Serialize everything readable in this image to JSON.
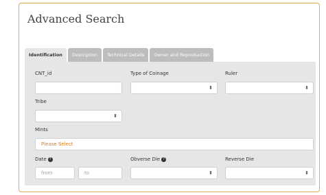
{
  "page": {
    "title": "Advanced Search"
  },
  "tabs": [
    {
      "label": "Identification"
    },
    {
      "label": "Description"
    },
    {
      "label": "Technical Details"
    },
    {
      "label": "Owner and Reproduction"
    }
  ],
  "form": {
    "cnt_id": {
      "label": "CNT_id",
      "value": ""
    },
    "type_of_coinage": {
      "label": "Type of Coinage",
      "value": ""
    },
    "ruler": {
      "label": "Ruler",
      "value": ""
    },
    "tribe": {
      "label": "Tribe",
      "value": ""
    },
    "mints": {
      "label": "Mints",
      "value": "Please Select"
    },
    "date": {
      "label": "Date",
      "from_placeholder": "from",
      "to_placeholder": "to"
    },
    "obverse_die": {
      "label": "Obverse Die",
      "value": ""
    },
    "reverse_die": {
      "label": "Reverse Die",
      "value": ""
    }
  },
  "icons": {
    "help": "?",
    "select_arrow": "⬍"
  },
  "colors": {
    "panel_border": "#e3a85a",
    "accent": "#e07b1c",
    "tab_inactive": "#bdbdbd",
    "tab_body": "#e6e6e6"
  }
}
